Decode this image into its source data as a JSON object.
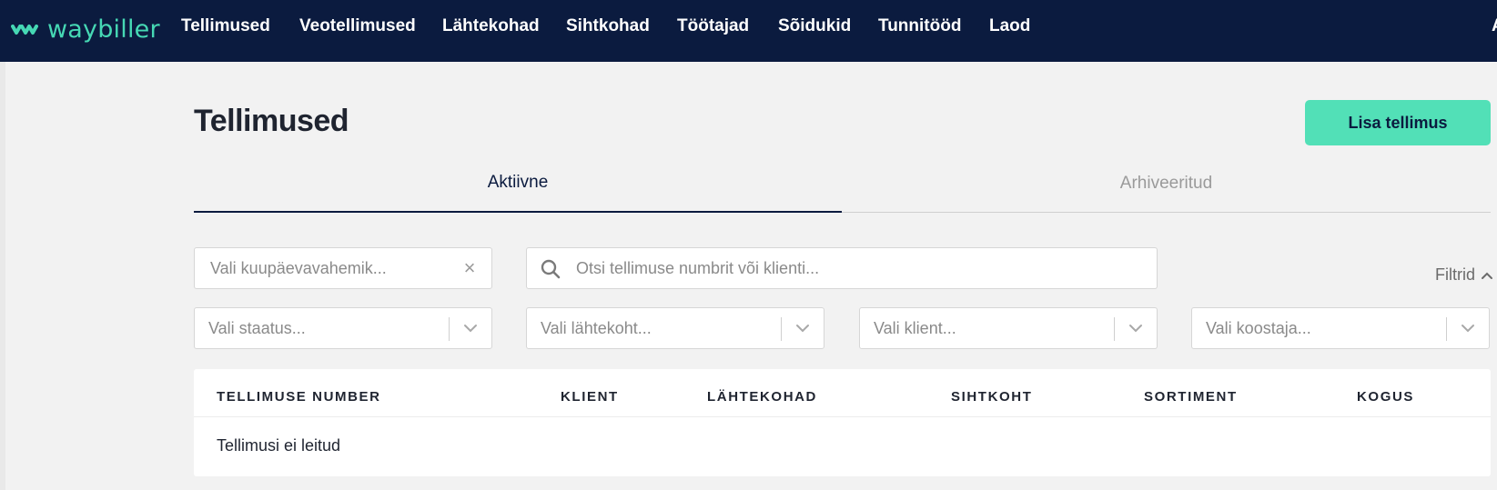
{
  "app": {
    "logo_text": "waybiller"
  },
  "nav": {
    "items": [
      {
        "label": "Tellimused"
      },
      {
        "label": "Veotellimused"
      },
      {
        "label": "Lähtekohad"
      },
      {
        "label": "Sihtkohad"
      },
      {
        "label": "Töötajad"
      },
      {
        "label": "Sõidukid"
      },
      {
        "label": "Tunnitööd"
      },
      {
        "label": "Laod"
      }
    ],
    "overflow_label": "A"
  },
  "page": {
    "title": "Tellimused",
    "add_button": "Lisa tellimus"
  },
  "tabs": [
    {
      "label": "Aktiivne",
      "active": true
    },
    {
      "label": "Arhiveeritud",
      "active": false
    }
  ],
  "filters": {
    "date_placeholder": "Vali kuupäevavahemik...",
    "search_placeholder": "Otsi tellimuse numbrit või klienti...",
    "toggle_label": "Filtrid",
    "status_placeholder": "Vali staatus...",
    "origin_placeholder": "Vali lähtekoht...",
    "client_placeholder": "Vali klient...",
    "creator_placeholder": "Vali koostaja..."
  },
  "table": {
    "columns": [
      "TELLIMUSE NUMBER",
      "KLIENT",
      "LÄHTEKOHAD",
      "SIHTKOHT",
      "SORTIMENT",
      "KOGUS"
    ],
    "empty_text": "Tellimusi ei leitud"
  },
  "colors": {
    "nav_bg": "#0b1b3f",
    "accent": "#52e0b7",
    "logo": "#46d8b4",
    "page_bg": "#f2f2f2"
  }
}
